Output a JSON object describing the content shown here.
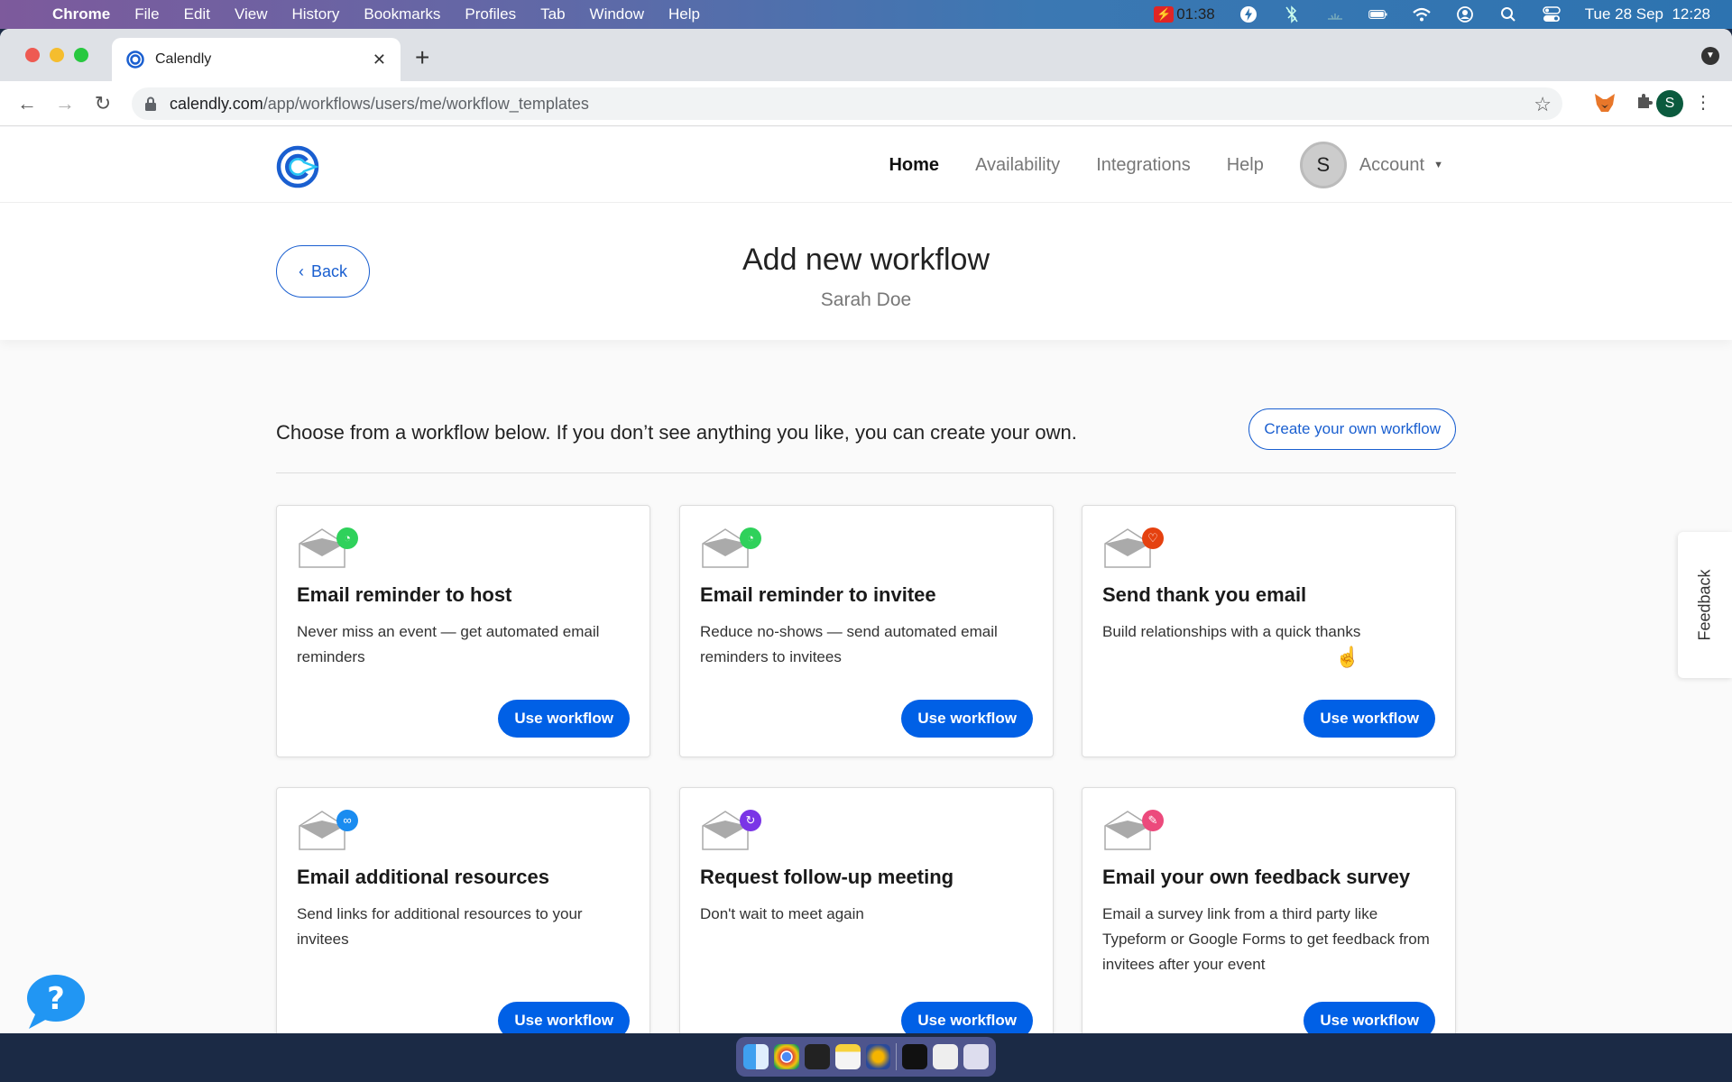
{
  "menubar": {
    "apple": "",
    "app_name": "Chrome",
    "items": [
      "File",
      "Edit",
      "View",
      "History",
      "Bookmarks",
      "Profiles",
      "Tab",
      "Window",
      "Help"
    ],
    "recording_time": "01:38",
    "datetime": "Tue 28 Sep  12:28"
  },
  "browser": {
    "tab_title": "Calendly",
    "url_host": "calendly.com",
    "url_path": "/app/workflows/users/me/workflow_templates",
    "profile_initial": "S"
  },
  "nav": {
    "links": [
      "Home",
      "Availability",
      "Integrations",
      "Help"
    ],
    "active": "Home",
    "avatar_initial": "S",
    "account_label": "Account"
  },
  "header": {
    "back_label": "Back",
    "title": "Add new workflow",
    "subtitle": "Sarah Doe"
  },
  "intro": {
    "text": "Choose from a workflow below. If you don’t see anything you like, you can create your own.",
    "create_button": "Create your own workflow"
  },
  "cards": [
    {
      "title": "Email reminder to host",
      "description": "Never miss an event — get automated email reminders",
      "badge_icon": "clock-icon",
      "badge_color": "#2fd15b",
      "button": "Use workflow"
    },
    {
      "title": "Email reminder to invitee",
      "description": "Reduce no-shows — send automated email reminders to invitees",
      "badge_icon": "clock-icon",
      "badge_color": "#2fd15b",
      "button": "Use workflow"
    },
    {
      "title": "Send thank you email",
      "description": "Build relationships with a quick thanks",
      "badge_icon": "heart-icon",
      "badge_color": "#e5410f",
      "button": "Use workflow"
    },
    {
      "title": "Email additional resources",
      "description": "Send links for additional resources to your invitees",
      "badge_icon": "link-icon",
      "badge_color": "#1a8cf0",
      "button": "Use workflow"
    },
    {
      "title": "Request follow-up meeting",
      "description": "Don't wait to meet again",
      "badge_icon": "refresh-icon",
      "badge_color": "#7a35e6",
      "button": "Use workflow"
    },
    {
      "title": "Email your own feedback survey",
      "description": "Email a survey link from a third party like Typeform or Google Forms to get feedback from invitees after your event",
      "badge_icon": "pencil-icon",
      "badge_color": "#ec4a7c",
      "button": "Use workflow"
    }
  ],
  "feedback_tab": "Feedback",
  "colors": {
    "primary": "#0060e6",
    "link": "#1a5fd0"
  }
}
